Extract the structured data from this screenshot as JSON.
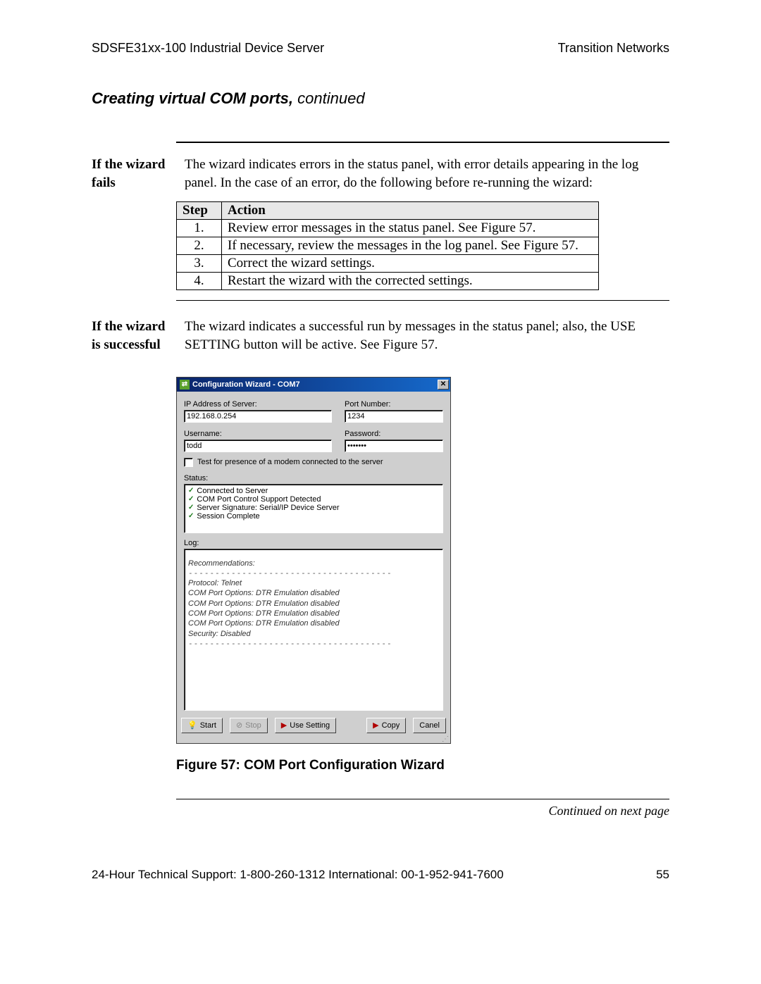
{
  "header": {
    "left": "SDSFE31xx-100 Industrial Device Server",
    "right": "Transition Networks"
  },
  "section_title": {
    "bold": "Creating virtual COM ports,",
    "rest": " continued"
  },
  "block1": {
    "label": "If the wizard fails",
    "text": "The wizard indicates errors in the status panel, with error details appearing in the log panel. In the case of an error, do the following before re-running the wizard:"
  },
  "step_table": {
    "head_step": "Step",
    "head_action": "Action",
    "rows": [
      {
        "n": "1.",
        "a": "Review error messages in the status panel. See Figure 57."
      },
      {
        "n": "2.",
        "a": "If necessary, review the messages in the log panel. See Figure 57."
      },
      {
        "n": "3.",
        "a": "Correct the wizard settings."
      },
      {
        "n": "4.",
        "a": "Restart the wizard with the corrected settings."
      }
    ]
  },
  "block2": {
    "label": "If the wizard is successful",
    "text": "The wizard indicates a successful run by messages in the status panel; also, the USE SETTING button will be active. See Figure 57."
  },
  "wizard": {
    "title": "Configuration Wizard - COM7",
    "ip_label": "IP Address of Server:",
    "ip_value": "192.168.0.254",
    "port_label": "Port Number:",
    "port_value": "1234",
    "user_label": "Username:",
    "user_value": "todd",
    "pass_label": "Password:",
    "pass_value": "xxxxxxx",
    "chk_label": "Test for presence of a modem connected to the server",
    "status_label": "Status:",
    "status_lines": [
      "Connected to Server",
      "COM Port Control Support Detected",
      "Server Signature: Serial/IP Device Server",
      "Session Complete"
    ],
    "log_label": "Log:",
    "log_rec": "Recommendations:",
    "log_div": "--------------------------------------",
    "log_proto": "Protocol:  Telnet",
    "log_opt": "COM Port Options:  DTR Emulation disabled",
    "log_sec": "Security:  Disabled",
    "btn_start": "Start",
    "btn_stop": "Stop",
    "btn_use": "Use Setting",
    "btn_copy": "Copy",
    "btn_cancel": "Canel"
  },
  "figure_caption": "Figure 57:  COM Port Configuration Wizard",
  "continued": "Continued on next page",
  "footer": {
    "left": "24-Hour Technical Support:  1-800-260-1312   International: 00-1-952-941-7600",
    "page": "55"
  }
}
